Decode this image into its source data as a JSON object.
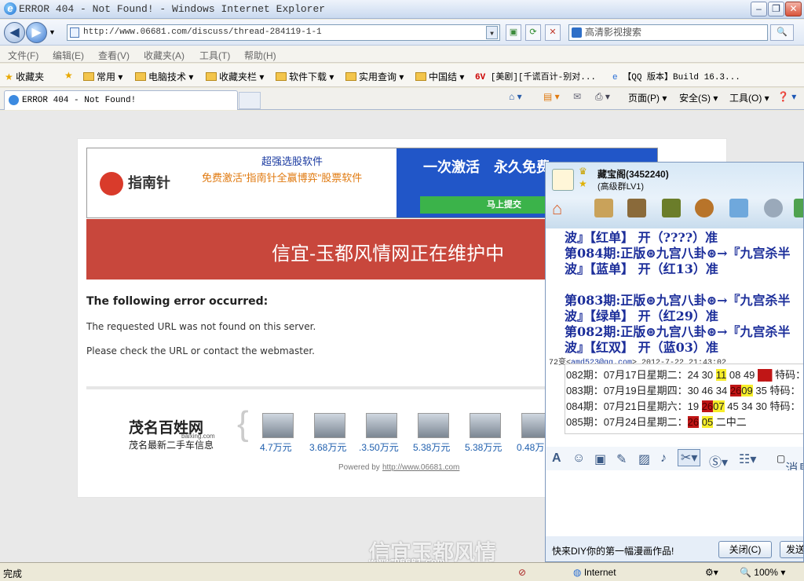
{
  "window": {
    "title": "ERROR 404 - Not Found! - Windows Internet Explorer"
  },
  "address": {
    "url": "http://www.06681.com/discuss/thread-284119-1-1",
    "search_placeholder": "高清影视搜索"
  },
  "menu": [
    "文件(F)",
    "编辑(E)",
    "查看(V)",
    "收藏夹(A)",
    "工具(T)",
    "帮助(H)"
  ],
  "favorites": {
    "label": "收藏夹",
    "items": [
      "常用",
      "电脑技术",
      "收藏夹栏",
      "软件下载",
      "实用查询",
      "中国结",
      "[美剧][千谎百计-别对...",
      "【QQ 版本】Build 16.3..."
    ]
  },
  "tab": {
    "label": "ERROR 404 - Not Found!"
  },
  "commands": {
    "page": "页面(P)",
    "safety": "安全(S)",
    "tools": "工具(O)"
  },
  "ad": {
    "headline": "超强选股软件",
    "sub": "免费激活\"指南针全赢博弈\"股票软件",
    "brand": "指南针",
    "right_text": "一次激活　永久免费",
    "button": "马上提交"
  },
  "page": {
    "banner": "信宜-玉都风情网正在维护中",
    "error_heading": "The following error occurred:",
    "error_line1": "The requested URL was not found on this server.",
    "error_line2": "Please check the URL or contact the webmaster.",
    "partner_name": "茂名百姓网",
    "partner_url": "baixing.com",
    "partner_caption": "茂名最新二手车信息",
    "prices": [
      "4.7万元",
      "3.68万元",
      ".3.50万元",
      "5.38万元",
      "5.38万元",
      "0.48万"
    ],
    "powered_label": "Powered by",
    "powered_link": "http://www.06681.com"
  },
  "qq": {
    "group_name": "藏宝阁(3452240)",
    "group_level": "(高级群LV1)",
    "messages": [
      "波』【红单】 开（????）准",
      "第084期:正版⊛九宫八卦⊛→『九宫杀半",
      "波』【蓝单】 开（红13）准",
      "第083期:正版⊛九宫八卦⊛→『九宫杀半",
      "波』【绿单】 开（红29）准",
      "第082期:正版⊛九宫八卦⊛→『九宫杀半",
      "波』【红双】 开（蓝03）准"
    ],
    "sender": "72变<",
    "sender_email": "amd523@qq.com",
    "sender_time": "> 2012-7-22 21:43:02",
    "table_rows": [
      {
        "pre": "082期：07月17日星期二：24 30 ",
        "y": "11",
        "mid": " 08 49 ",
        "r": "██",
        "post": " 特码："
      },
      {
        "pre": "083期：07月19日星期四：30 46 34 ",
        "r": "26",
        "y": "09",
        "post": " 35 特码："
      },
      {
        "pre": "084期：07月21日星期六：19 ",
        "r": "26",
        "y": "07",
        "post": " 45 34 30 特码："
      },
      {
        "pre": "085期：07月24日星期二：",
        "r": "26",
        "y": "05",
        "post": " 二中二"
      }
    ],
    "tool_label": "消息",
    "tip": "快来DIY你的第一幅漫画作品!",
    "close_btn": "关闭(C)",
    "send_btn": "发送"
  },
  "status": {
    "left": "完成",
    "zone": "Internet",
    "zoom": "100%"
  },
  "watermark": {
    "title": "信宜玉都风情",
    "url": "www.06681.com"
  }
}
